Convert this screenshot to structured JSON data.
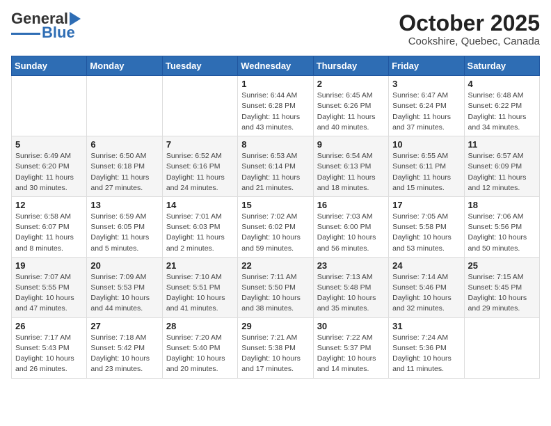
{
  "header": {
    "logo_general": "General",
    "logo_blue": "Blue",
    "month_title": "October 2025",
    "location": "Cookshire, Quebec, Canada"
  },
  "weekdays": [
    "Sunday",
    "Monday",
    "Tuesday",
    "Wednesday",
    "Thursday",
    "Friday",
    "Saturday"
  ],
  "weeks": [
    [
      {
        "day": "",
        "info": ""
      },
      {
        "day": "",
        "info": ""
      },
      {
        "day": "",
        "info": ""
      },
      {
        "day": "1",
        "info": "Sunrise: 6:44 AM\nSunset: 6:28 PM\nDaylight: 11 hours\nand 43 minutes."
      },
      {
        "day": "2",
        "info": "Sunrise: 6:45 AM\nSunset: 6:26 PM\nDaylight: 11 hours\nand 40 minutes."
      },
      {
        "day": "3",
        "info": "Sunrise: 6:47 AM\nSunset: 6:24 PM\nDaylight: 11 hours\nand 37 minutes."
      },
      {
        "day": "4",
        "info": "Sunrise: 6:48 AM\nSunset: 6:22 PM\nDaylight: 11 hours\nand 34 minutes."
      }
    ],
    [
      {
        "day": "5",
        "info": "Sunrise: 6:49 AM\nSunset: 6:20 PM\nDaylight: 11 hours\nand 30 minutes."
      },
      {
        "day": "6",
        "info": "Sunrise: 6:50 AM\nSunset: 6:18 PM\nDaylight: 11 hours\nand 27 minutes."
      },
      {
        "day": "7",
        "info": "Sunrise: 6:52 AM\nSunset: 6:16 PM\nDaylight: 11 hours\nand 24 minutes."
      },
      {
        "day": "8",
        "info": "Sunrise: 6:53 AM\nSunset: 6:14 PM\nDaylight: 11 hours\nand 21 minutes."
      },
      {
        "day": "9",
        "info": "Sunrise: 6:54 AM\nSunset: 6:13 PM\nDaylight: 11 hours\nand 18 minutes."
      },
      {
        "day": "10",
        "info": "Sunrise: 6:55 AM\nSunset: 6:11 PM\nDaylight: 11 hours\nand 15 minutes."
      },
      {
        "day": "11",
        "info": "Sunrise: 6:57 AM\nSunset: 6:09 PM\nDaylight: 11 hours\nand 12 minutes."
      }
    ],
    [
      {
        "day": "12",
        "info": "Sunrise: 6:58 AM\nSunset: 6:07 PM\nDaylight: 11 hours\nand 8 minutes."
      },
      {
        "day": "13",
        "info": "Sunrise: 6:59 AM\nSunset: 6:05 PM\nDaylight: 11 hours\nand 5 minutes."
      },
      {
        "day": "14",
        "info": "Sunrise: 7:01 AM\nSunset: 6:03 PM\nDaylight: 11 hours\nand 2 minutes."
      },
      {
        "day": "15",
        "info": "Sunrise: 7:02 AM\nSunset: 6:02 PM\nDaylight: 10 hours\nand 59 minutes."
      },
      {
        "day": "16",
        "info": "Sunrise: 7:03 AM\nSunset: 6:00 PM\nDaylight: 10 hours\nand 56 minutes."
      },
      {
        "day": "17",
        "info": "Sunrise: 7:05 AM\nSunset: 5:58 PM\nDaylight: 10 hours\nand 53 minutes."
      },
      {
        "day": "18",
        "info": "Sunrise: 7:06 AM\nSunset: 5:56 PM\nDaylight: 10 hours\nand 50 minutes."
      }
    ],
    [
      {
        "day": "19",
        "info": "Sunrise: 7:07 AM\nSunset: 5:55 PM\nDaylight: 10 hours\nand 47 minutes."
      },
      {
        "day": "20",
        "info": "Sunrise: 7:09 AM\nSunset: 5:53 PM\nDaylight: 10 hours\nand 44 minutes."
      },
      {
        "day": "21",
        "info": "Sunrise: 7:10 AM\nSunset: 5:51 PM\nDaylight: 10 hours\nand 41 minutes."
      },
      {
        "day": "22",
        "info": "Sunrise: 7:11 AM\nSunset: 5:50 PM\nDaylight: 10 hours\nand 38 minutes."
      },
      {
        "day": "23",
        "info": "Sunrise: 7:13 AM\nSunset: 5:48 PM\nDaylight: 10 hours\nand 35 minutes."
      },
      {
        "day": "24",
        "info": "Sunrise: 7:14 AM\nSunset: 5:46 PM\nDaylight: 10 hours\nand 32 minutes."
      },
      {
        "day": "25",
        "info": "Sunrise: 7:15 AM\nSunset: 5:45 PM\nDaylight: 10 hours\nand 29 minutes."
      }
    ],
    [
      {
        "day": "26",
        "info": "Sunrise: 7:17 AM\nSunset: 5:43 PM\nDaylight: 10 hours\nand 26 minutes."
      },
      {
        "day": "27",
        "info": "Sunrise: 7:18 AM\nSunset: 5:42 PM\nDaylight: 10 hours\nand 23 minutes."
      },
      {
        "day": "28",
        "info": "Sunrise: 7:20 AM\nSunset: 5:40 PM\nDaylight: 10 hours\nand 20 minutes."
      },
      {
        "day": "29",
        "info": "Sunrise: 7:21 AM\nSunset: 5:38 PM\nDaylight: 10 hours\nand 17 minutes."
      },
      {
        "day": "30",
        "info": "Sunrise: 7:22 AM\nSunset: 5:37 PM\nDaylight: 10 hours\nand 14 minutes."
      },
      {
        "day": "31",
        "info": "Sunrise: 7:24 AM\nSunset: 5:36 PM\nDaylight: 10 hours\nand 11 minutes."
      },
      {
        "day": "",
        "info": ""
      }
    ]
  ]
}
